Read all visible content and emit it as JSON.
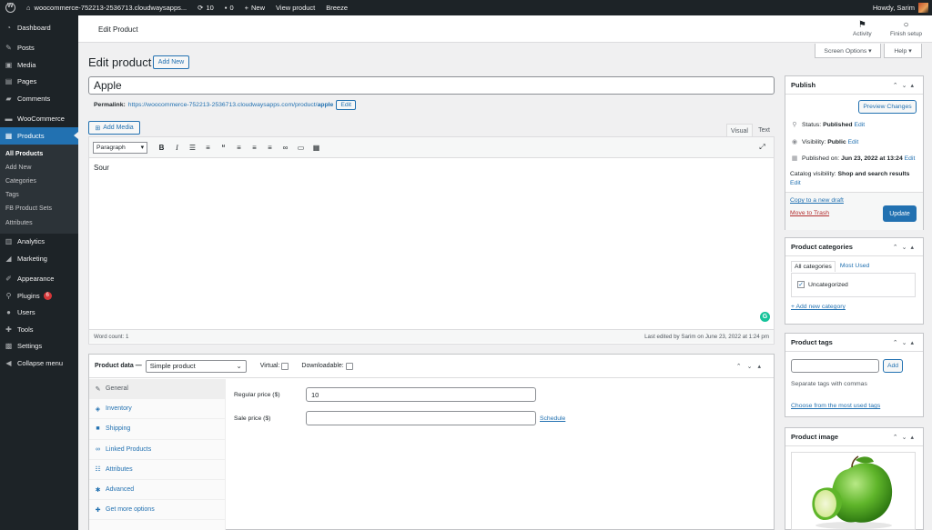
{
  "adminbar": {
    "site": "woocommerce-752213-2536713.cloudwaysapps...",
    "updates": "10",
    "comments": "0",
    "new": "New",
    "view_product": "View product",
    "breeze": "Breeze",
    "howdy": "Howdy, Sarim"
  },
  "sidebar": {
    "items": [
      {
        "label": "Dashboard",
        "icon": "dashboard-icon"
      },
      {
        "label": "Posts",
        "icon": "pin-icon"
      },
      {
        "label": "Media",
        "icon": "media-icon"
      },
      {
        "label": "Pages",
        "icon": "pages-icon"
      },
      {
        "label": "Comments",
        "icon": "comments-icon"
      },
      {
        "label": "WooCommerce",
        "icon": "woocommerce-icon"
      },
      {
        "label": "Products",
        "icon": "products-icon"
      },
      {
        "label": "Analytics",
        "icon": "analytics-icon"
      },
      {
        "label": "Marketing",
        "icon": "marketing-icon"
      },
      {
        "label": "Appearance",
        "icon": "appearance-icon"
      },
      {
        "label": "Plugins",
        "icon": "plugins-icon",
        "badge": "6"
      },
      {
        "label": "Users",
        "icon": "users-icon"
      },
      {
        "label": "Tools",
        "icon": "tools-icon"
      },
      {
        "label": "Settings",
        "icon": "settings-icon"
      },
      {
        "label": "Collapse menu",
        "icon": "collapse-icon"
      }
    ],
    "submenu": [
      "All Products",
      "Add New",
      "Categories",
      "Tags",
      "FB Product Sets",
      "Attributes"
    ]
  },
  "header": {
    "title": "Edit Product",
    "activity": "Activity",
    "finish_setup": "Finish setup",
    "screen_options": "Screen Options ▾",
    "help": "Help ▾"
  },
  "main": {
    "heading": "Edit product",
    "add_new": "Add New",
    "product_title": "Apple",
    "permalink_label": "Permalink:",
    "permalink_base": "https://woocommerce-752213-2536713.cloudwaysapps.com/product/",
    "permalink_slug": "apple",
    "permalink_edit": "Edit",
    "add_media": "Add Media",
    "tab_visual": "Visual",
    "tab_text": "Text",
    "format_select": "Paragraph",
    "content": "Sour",
    "word_count": "Word count: 1",
    "last_edited": "Last edited by Sarim on June 23, 2022 at 1:24 pm"
  },
  "product_data": {
    "label": "Product data —",
    "type": "Simple product",
    "virtual": "Virtual:",
    "downloadable": "Downloadable:",
    "tabs": [
      "General",
      "Inventory",
      "Shipping",
      "Linked Products",
      "Attributes",
      "Advanced",
      "Get more options"
    ],
    "regular_price_label": "Regular price ($)",
    "regular_price": "10",
    "sale_price_label": "Sale price ($)",
    "sale_price": "",
    "schedule": "Schedule"
  },
  "publish": {
    "title": "Publish",
    "preview": "Preview Changes",
    "status_label": "Status:",
    "status_value": "Published",
    "visibility_label": "Visibility:",
    "visibility_value": "Public",
    "published_label": "Published on:",
    "published_value": "Jun 23, 2022 at 13:24",
    "edit": "Edit",
    "catalog_label": "Catalog visibility:",
    "catalog_value": "Shop and search results",
    "copy_draft": "Copy to a new draft",
    "trash": "Move to Trash",
    "update": "Update"
  },
  "categories": {
    "title": "Product categories",
    "tab_all": "All categories",
    "tab_most_used": "Most Used",
    "item": "Uncategorized",
    "add_new": "+ Add new category"
  },
  "tags": {
    "title": "Product tags",
    "add": "Add",
    "hint": "Separate tags with commas",
    "choose": "Choose from the most used tags"
  },
  "image": {
    "title": "Product image"
  },
  "colors": {
    "accent": "#2271b1",
    "adminbar": "#1d2327",
    "danger": "#d63638"
  }
}
